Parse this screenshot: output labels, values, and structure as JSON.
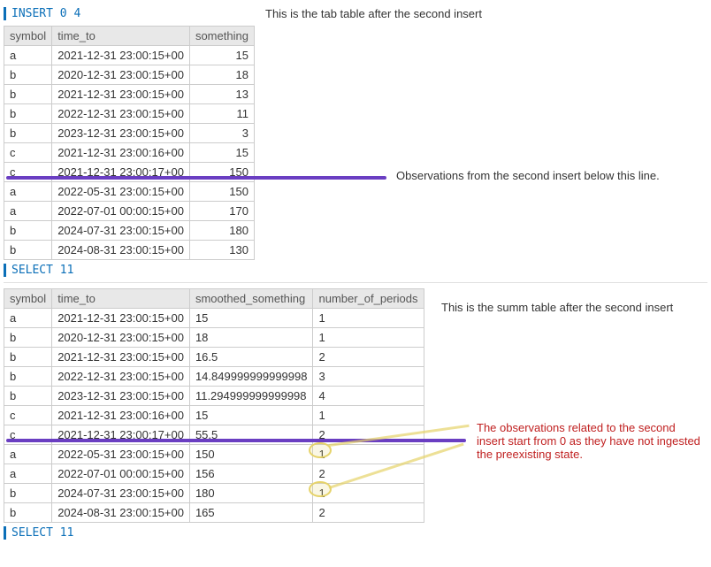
{
  "line1": "INSERT 0 4",
  "annot1": "This is the tab table after the second insert",
  "table1": {
    "headers": [
      "symbol",
      "time_to",
      "something"
    ],
    "rows": [
      [
        "a",
        "2021-12-31 23:00:15+00",
        "15"
      ],
      [
        "b",
        "2020-12-31 23:00:15+00",
        "18"
      ],
      [
        "b",
        "2021-12-31 23:00:15+00",
        "13"
      ],
      [
        "b",
        "2022-12-31 23:00:15+00",
        "11"
      ],
      [
        "b",
        "2023-12-31 23:00:15+00",
        "3"
      ],
      [
        "c",
        "2021-12-31 23:00:16+00",
        "15"
      ],
      [
        "c",
        "2021-12-31 23:00:17+00",
        "150"
      ],
      [
        "a",
        "2022-05-31 23:00:15+00",
        "150"
      ],
      [
        "a",
        "2022-07-01 00:00:15+00",
        "170"
      ],
      [
        "b",
        "2024-07-31 23:00:15+00",
        "180"
      ],
      [
        "b",
        "2024-08-31 23:00:15+00",
        "130"
      ]
    ]
  },
  "annot2": "Observations from the second insert below this line.",
  "line2": "SELECT 11",
  "annot3": "This is the summ table after the second insert",
  "table2": {
    "headers": [
      "symbol",
      "time_to",
      "smoothed_something",
      "number_of_periods"
    ],
    "rows": [
      [
        "a",
        "2021-12-31 23:00:15+00",
        "15",
        "1"
      ],
      [
        "b",
        "2020-12-31 23:00:15+00",
        "18",
        "1"
      ],
      [
        "b",
        "2021-12-31 23:00:15+00",
        "16.5",
        "2"
      ],
      [
        "b",
        "2022-12-31 23:00:15+00",
        "14.849999999999998",
        "3"
      ],
      [
        "b",
        "2023-12-31 23:00:15+00",
        "11.294999999999998",
        "4"
      ],
      [
        "c",
        "2021-12-31 23:00:16+00",
        "15",
        "1"
      ],
      [
        "c",
        "2021-12-31 23:00:17+00",
        "55.5",
        "2"
      ],
      [
        "a",
        "2022-05-31 23:00:15+00",
        "150",
        "1"
      ],
      [
        "a",
        "2022-07-01 00:00:15+00",
        "156",
        "2"
      ],
      [
        "b",
        "2024-07-31 23:00:15+00",
        "180",
        "1"
      ],
      [
        "b",
        "2024-08-31 23:00:15+00",
        "165",
        "2"
      ]
    ]
  },
  "annot4": "The observations related to the second insert start from 0 as they have not ingested the preexisting state.",
  "line3": "SELECT 11"
}
